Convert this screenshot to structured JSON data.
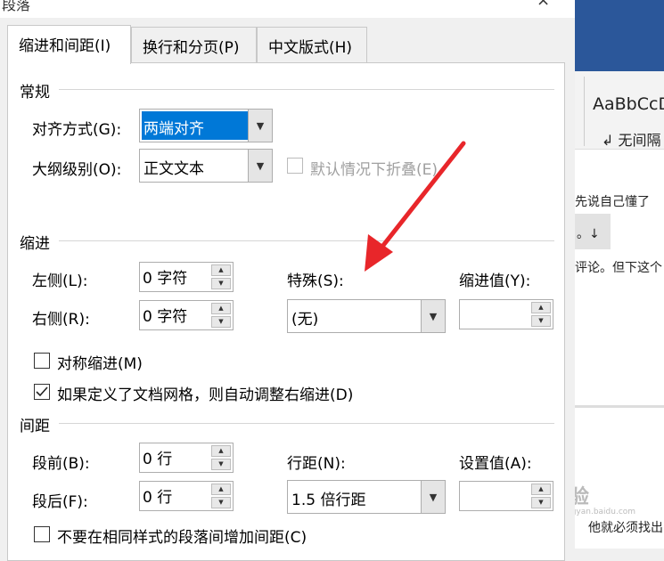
{
  "dialog": {
    "title": "段落",
    "close_glyph": "×"
  },
  "tabs": [
    {
      "label": "缩进和间距(I)",
      "active": true
    },
    {
      "label": "换行和分页(P)",
      "active": false
    },
    {
      "label": "中文版式(H)",
      "active": false
    }
  ],
  "general": {
    "section": "常规",
    "alignment_label": "对齐方式(G):",
    "alignment_value": "两端对齐",
    "outline_label": "大纲级别(O):",
    "outline_value": "正文文本",
    "collapse_label": "默认情况下折叠(E)"
  },
  "indent": {
    "section": "缩进",
    "left_label": "左侧(L):",
    "left_value": "0 字符",
    "right_label": "右侧(R):",
    "right_value": "0 字符",
    "special_label": "特殊(S):",
    "special_value": "(无)",
    "by_label": "缩进值(Y):",
    "by_value": "",
    "mirror_label": "对称缩进(M)",
    "mirror_checked": false,
    "grid_label": "如果定义了文档网格，则自动调整右缩进(D)",
    "grid_checked": true
  },
  "spacing": {
    "section": "间距",
    "before_label": "段前(B):",
    "before_value": "0 行",
    "after_label": "段后(F):",
    "after_value": "0 行",
    "line_label": "行距(N):",
    "line_value": "1.5 倍行距",
    "at_label": "设置值(A):",
    "at_value": "",
    "no_space_label": "不要在相同样式的段落间增加间距(C)",
    "no_space_checked": false
  },
  "background_doc": {
    "style_sample": "AaBbCcD",
    "style_name": "↲ 无间隔",
    "line1": "先说自己懂了",
    "line2": "。↓",
    "line3": "评论。但下这个",
    "line4": "他就必须找出",
    "watermark": "Bai  经验",
    "watermark_url": "jingyan.baidu.com"
  },
  "colors": {
    "arrow": "#e8262a",
    "selection": "#0078d7",
    "ribbon": "#2b579a"
  }
}
